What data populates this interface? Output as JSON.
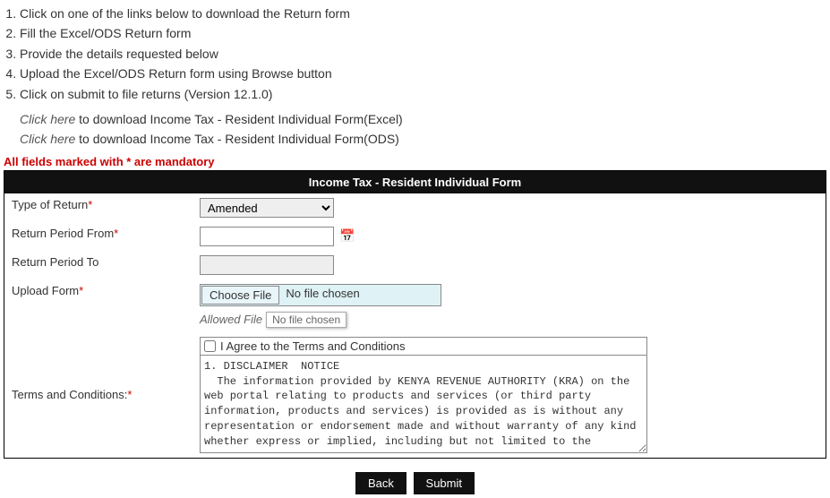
{
  "instructions": [
    "Click on one of the links below to download the Return form",
    "Fill the Excel/ODS Return form",
    "Provide the details requested below",
    "Upload the Excel/ODS Return form using Browse button",
    "Click on submit to file returns (Version 12.1.0)"
  ],
  "download_links": [
    {
      "link_text": "Click here",
      "rest": " to download Income Tax - Resident Individual Form(Excel)"
    },
    {
      "link_text": "Click here",
      "rest": " to download Income Tax - Resident Individual Form(ODS)"
    }
  ],
  "mandatory_note": "All fields marked with * are mandatory",
  "form_title": "Income Tax - Resident Individual Form",
  "labels": {
    "type_of_return": "Type of Return",
    "return_period_from": "Return Period From",
    "return_period_to": "Return Period To",
    "upload_form": "Upload Form",
    "terms": "Terms and Conditions:"
  },
  "type_of_return_value": "Amended",
  "return_from_value": "",
  "return_to_value": "",
  "file": {
    "choose_label": "Choose File",
    "status": "No file chosen",
    "allowed_prefix": "Allowed File",
    "tooltip": "No file chosen"
  },
  "agree_label": "I Agree to the Terms and Conditions",
  "terms_text": "1. DISCLAIMER  NOTICE\n  The information provided by KENYA REVENUE AUTHORITY (KRA) on the web portal relating to products and services (or third party information, products and services) is provided as is without any representation or endorsement made and without warranty of any kind whether express or implied, including but not limited to the",
  "buttons": {
    "back": "Back",
    "submit": "Submit"
  }
}
